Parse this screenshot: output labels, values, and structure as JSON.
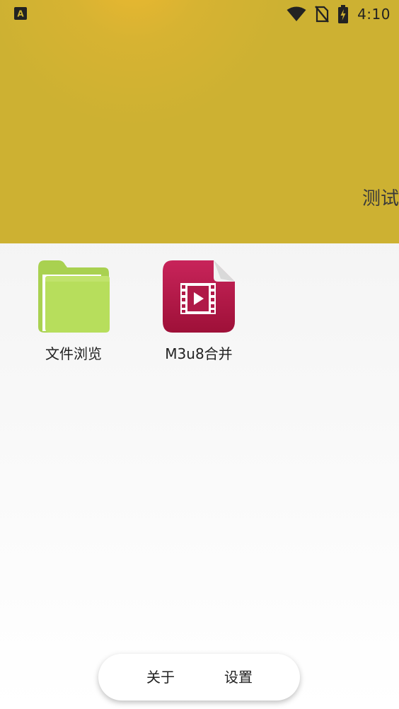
{
  "status_bar": {
    "time": "4:10",
    "left_icon": "a-notification-icon",
    "icons": [
      "wifi-icon",
      "no-sim-icon",
      "battery-charging-icon"
    ]
  },
  "header": {
    "title": "测试",
    "color": "#cdb132"
  },
  "apps": [
    {
      "label": "文件浏览",
      "icon": "folder-icon"
    },
    {
      "label": "M3u8合并",
      "icon": "video-file-icon"
    }
  ],
  "bottom_bar": {
    "about_label": "关于",
    "settings_label": "设置"
  }
}
